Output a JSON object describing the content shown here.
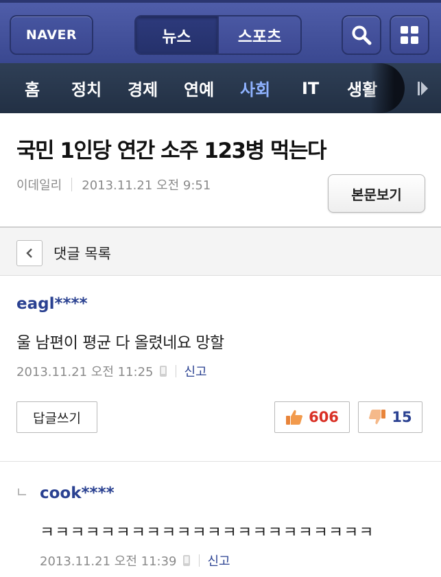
{
  "header": {
    "logo": "NAVER",
    "tabs": [
      {
        "label": "뉴스",
        "active": true
      },
      {
        "label": "스포츠",
        "active": false
      }
    ],
    "search_icon": "search-icon",
    "menu_icon": "grid-menu-icon"
  },
  "categories": [
    {
      "label": "홈"
    },
    {
      "label": "정치"
    },
    {
      "label": "경제"
    },
    {
      "label": "연예"
    },
    {
      "label": "사회",
      "active": true
    },
    {
      "label": "IT"
    },
    {
      "label": "생활"
    }
  ],
  "article": {
    "title": "국민 1인당 연간 소주 123병 먹는다",
    "source": "이데일리",
    "datetime": "2013.11.21 오전 9:51",
    "view_button": "본문보기"
  },
  "comment_list": {
    "title": "댓글 목록"
  },
  "comments": [
    {
      "user": "eagl****",
      "text": "울 남편이 평균 다 올렸네요 망할",
      "datetime": "2013.11.21 오전 11:25",
      "report": "신고",
      "reply_button": "답글쓰기",
      "likes": "606",
      "dislikes": "15"
    }
  ],
  "replies": [
    {
      "user": "cook****",
      "text": "ㅋㅋㅋㅋㅋㅋㅋㅋㅋㅋㅋㅋㅋㅋㅋㅋㅋㅋㅋㅋㅋㅋ",
      "datetime": "2013.11.21 오전 11:39",
      "report": "신고"
    }
  ],
  "colors": {
    "header_blue": "#3f4d98",
    "nav_dark": "#2a3850",
    "active_category": "#8fb2ff",
    "username": "#2a4191",
    "like_red": "#d93025",
    "dislike_blue": "#2a4191"
  }
}
